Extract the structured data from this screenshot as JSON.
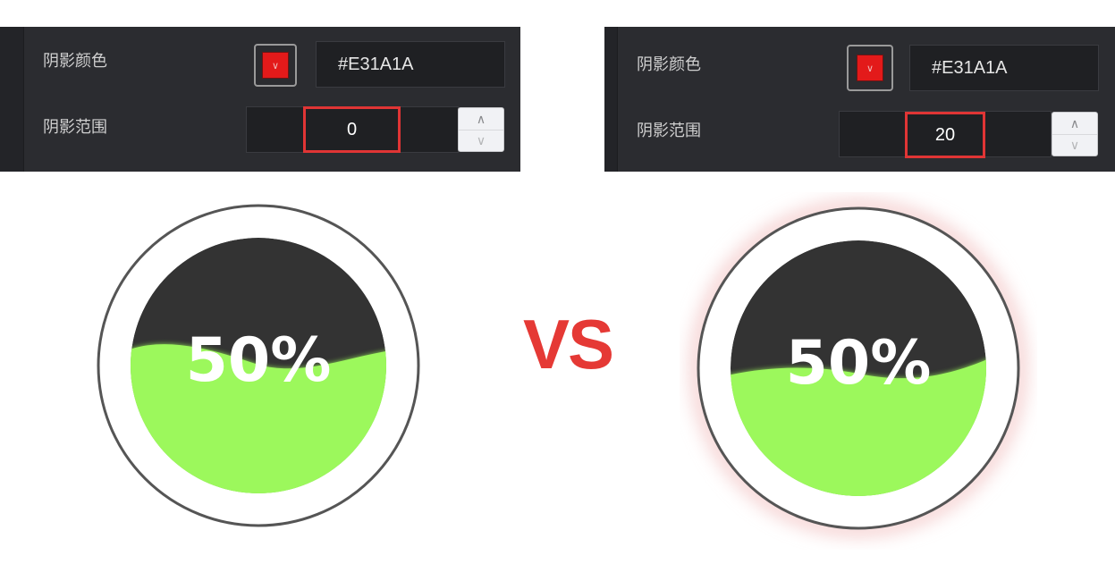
{
  "colors": {
    "shadow_red": "#E31A1A",
    "liquid_green": "#9CF85C",
    "empty_dark": "#333333",
    "ring": "#555555",
    "vs_red": "#E53935"
  },
  "left_panel": {
    "shadow_color_label": "阴影颜色",
    "shadow_color_hex": "#E31A1A",
    "shadow_range_label": "阴影范围",
    "shadow_range_value": "0"
  },
  "right_panel": {
    "shadow_color_label": "阴影颜色",
    "shadow_color_hex": "#E31A1A",
    "shadow_range_label": "阴影范围",
    "shadow_range_value": "20"
  },
  "icons": {
    "swatch": "chevron-down-icon",
    "stepper_up": "chevron-up-icon",
    "stepper_down": "chevron-down-icon"
  },
  "vs_text": "VS",
  "left_gauge": {
    "text": "50%",
    "progress": 0.5,
    "shadow_range": 0
  },
  "right_gauge": {
    "text": "50%",
    "progress": 0.5,
    "shadow_range": 20
  }
}
